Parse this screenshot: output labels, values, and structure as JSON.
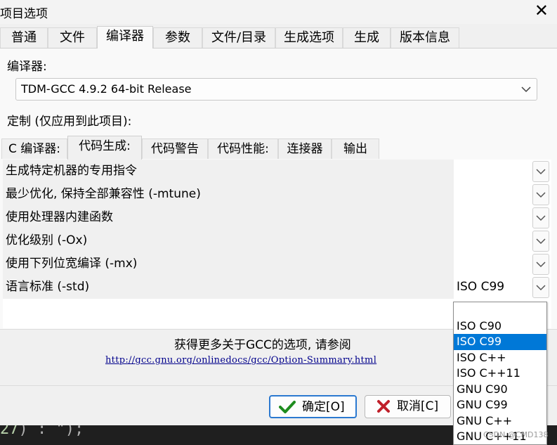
{
  "window": {
    "title": "项目选项",
    "close_symbol": "✕"
  },
  "tabs": [
    "普通",
    "文件",
    "编译器",
    "参数",
    "文件/目录",
    "生成选项",
    "生成",
    "版本信息"
  ],
  "active_tab": "编译器",
  "compiler": {
    "label": "编译器:",
    "selected": "TDM-GCC 4.9.2 64-bit Release",
    "custom_label": "定制 (仅应用到此项目):"
  },
  "subtabs": [
    "C 编译器:",
    "代码生成:",
    "代码警告",
    "代码性能:",
    "连接器",
    "输出"
  ],
  "active_subtab": "代码生成:",
  "options": [
    {
      "name": "生成特定机器的专用指令",
      "value": ""
    },
    {
      "name": "最少优化, 保持全部兼容性 (-mtune)",
      "value": ""
    },
    {
      "name": "使用处理器内建函数",
      "value": ""
    },
    {
      "name": "优化级别 (-Ox)",
      "value": ""
    },
    {
      "name": "使用下列位宽编译 (-mx)",
      "value": ""
    },
    {
      "name": "语言标准 (-std)",
      "value": "ISO C99"
    }
  ],
  "std_dropdown": {
    "items": [
      "",
      "ISO C90",
      "ISO C99",
      "ISO C++",
      "ISO C++11",
      "GNU C90",
      "GNU C99",
      "GNU C++",
      "GNU C++11"
    ],
    "selected": "ISO C99"
  },
  "info": {
    "text": "获得更多关于GCC的选项, 请参阅",
    "link": "http://gcc.gnu.org/onlinedocs/gcc/Option-Summary.html"
  },
  "buttons": {
    "ok": "确定[O]",
    "cancel": "取消[C]"
  },
  "editor_fragment": {
    "num": "27",
    "rest": ") : \");"
  },
  "watermark": "CSDN @CMD138",
  "colors": {
    "selection": "#0078d7",
    "ok_border": "#2b79d0",
    "ok_check": "#1e8c1e",
    "cancel_x": "#c0202a",
    "link": "#00008b"
  }
}
